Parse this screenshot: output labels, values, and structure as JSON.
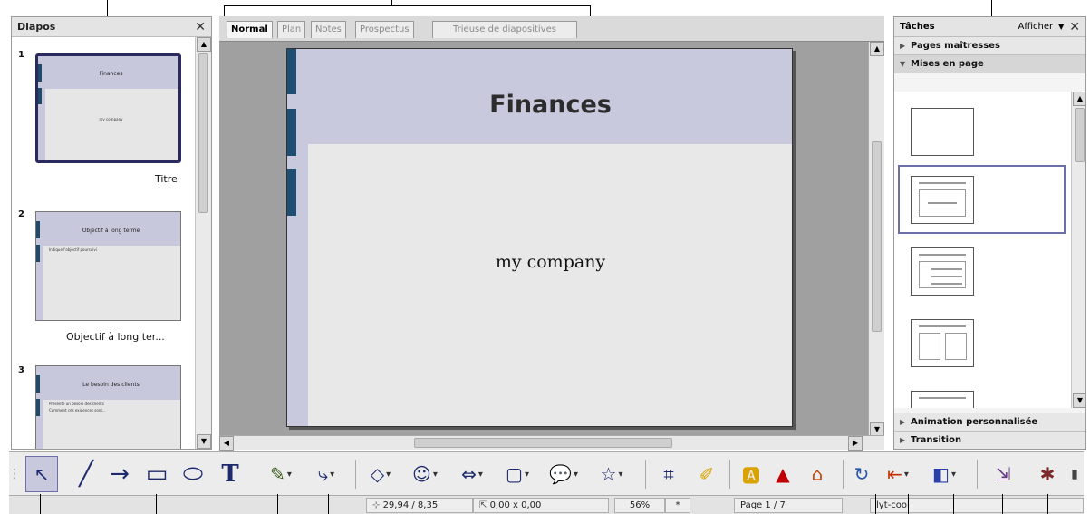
{
  "slides_pane": {
    "title": "Diapos",
    "close_icon": "close-icon",
    "slides": [
      {
        "number": "1",
        "title": "Finances",
        "subtitle": "my company",
        "caption": "Titre"
      },
      {
        "number": "2",
        "title": "Objectif à long terme",
        "bullets": [
          "Indique l'objectif poursuivi"
        ],
        "caption": "Objectif à long ter..."
      },
      {
        "number": "3",
        "title": "Le besoin des clients",
        "bullets": [
          "Présente un besoin des clients",
          "Comment ces exigences sont..."
        ],
        "caption": ""
      }
    ]
  },
  "view_tabs": [
    "Normal",
    "Plan",
    "Notes",
    "Prospectus",
    "Trieuse de diapositives"
  ],
  "slide": {
    "title": "Finances",
    "subtitle": "my company"
  },
  "tasks_pane": {
    "title": "Tâches",
    "view_menu": "Afficher",
    "sections": [
      "Pages maîtresses",
      "Mises en page",
      "Animation personnalisée",
      "Transition"
    ]
  },
  "toolbar": {
    "tools": [
      "select-icon",
      "line-icon",
      "arrow-icon",
      "rectangle-icon",
      "ellipse-icon",
      "text-icon",
      "curve-icon",
      "connector-icon",
      "basic-shapes-icon",
      "symbol-shapes-icon",
      "block-arrows-icon",
      "flowchart-icon",
      "callouts-icon",
      "stars-icon",
      "points-icon",
      "glue-points-icon",
      "fontwork-icon",
      "from-file-icon",
      "gallery-icon",
      "rotate-icon",
      "alignment-icon",
      "arrange-icon",
      "interaction-icon",
      "effects-icon"
    ],
    "text_tool_label": "T"
  },
  "status_bar": {
    "position": "29,94 / 8,35",
    "size": "0,00 x 0,00",
    "zoom": "56%",
    "modified": "*",
    "page": "Page 1 / 7",
    "layout": "lyt-cool"
  }
}
